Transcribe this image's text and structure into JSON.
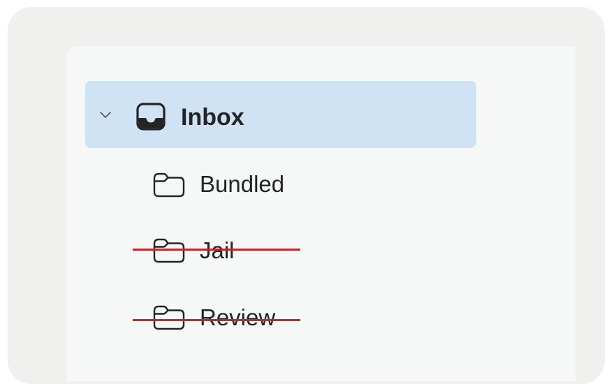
{
  "folder_tree": {
    "inbox": {
      "label": "Inbox",
      "icon": "inbox-icon",
      "expanded": true,
      "selected": true
    },
    "subfolders": [
      {
        "label": "Bundled",
        "icon": "folder-icon",
        "struck_through": false
      },
      {
        "label": "Jail",
        "icon": "folder-icon",
        "struck_through": true
      },
      {
        "label": "Review",
        "icon": "folder-icon",
        "struck_through": true
      }
    ]
  },
  "colors": {
    "selected_background": "#cfe3f4",
    "strike_line": "#c1272d",
    "text": "#242424"
  }
}
